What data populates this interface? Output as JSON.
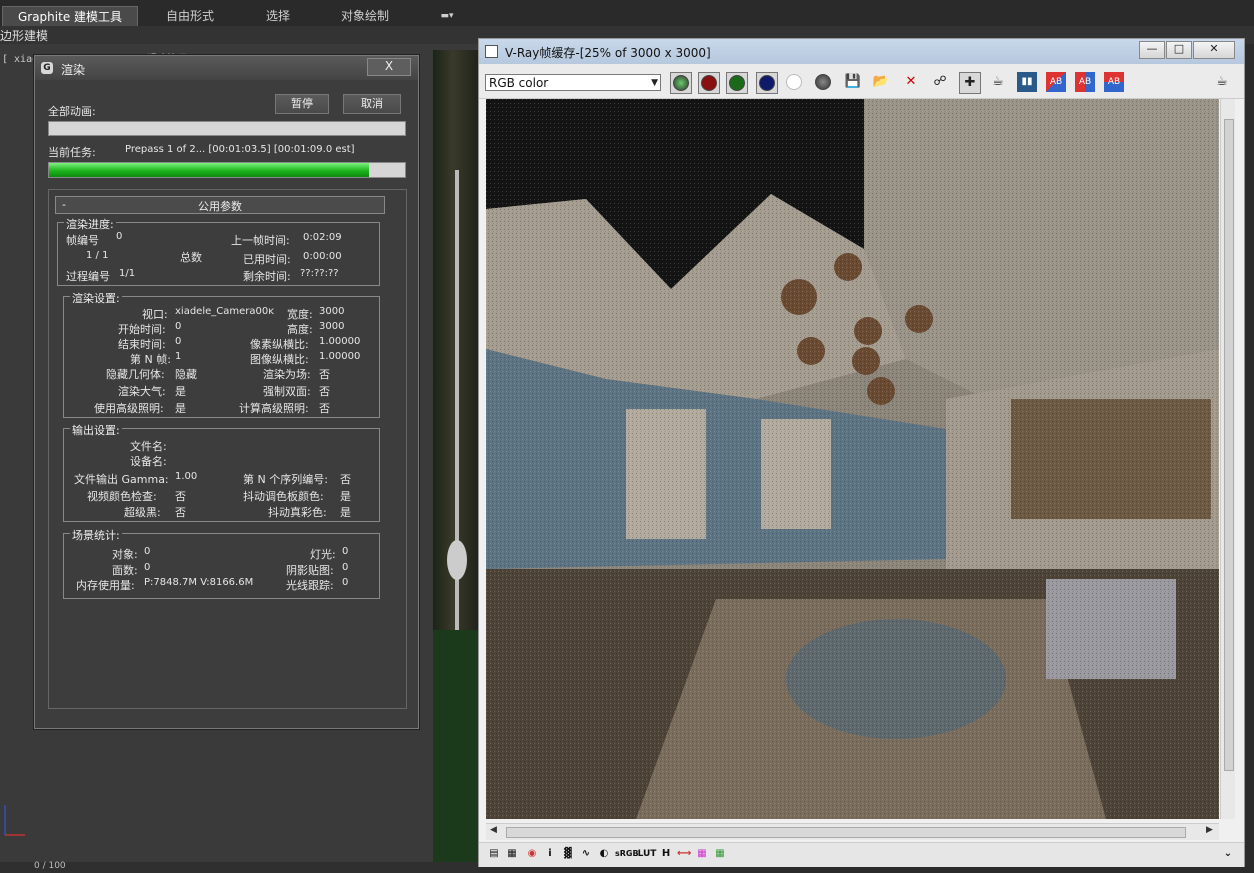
{
  "ribbon": {
    "tabs": [
      {
        "label": "Graphite 建模工具"
      },
      {
        "label": "自由形式"
      },
      {
        "label": "选择"
      },
      {
        "label": "对象绘制"
      }
    ],
    "sub_label": "边形建模"
  },
  "viewport": {
    "label": "[ xiadele_Camera004 ] [ 明暗处理 ]",
    "frame_counter": "0 / 100"
  },
  "render_dialog": {
    "title": "渲染",
    "close_label": "X",
    "all_anim_label": "全部动画:",
    "pause_label": "暂停",
    "cancel_label": "取消",
    "current_task_label": "当前任务:",
    "current_task_value": "Prepass 1 of 2... [00:01:03.5] [00:01:09.0 est]",
    "all_anim_progress": 0.0,
    "current_task_progress": 0.9,
    "rollout_sign": "-",
    "rollout_title": "公用参数",
    "progress_group": {
      "title": "渲染进度:",
      "frame_label": "帧编号",
      "frame_value": "0",
      "last_frame_label": "上一帧时间:",
      "last_frame_value": "0:02:09",
      "count_value": "1 / 1",
      "total_label": "总数",
      "elapsed_label": "已用时间:",
      "elapsed_value": "0:00:00",
      "pass_label": "过程编号",
      "pass_value": "1/1",
      "remaining_label": "剩余时间:",
      "remaining_value": "??:??:??"
    },
    "settings_group": {
      "title": "渲染设置:",
      "viewport_label": "视口:",
      "viewport_value": "xiadele_Camera00ĸ",
      "width_label": "宽度:",
      "width_value": "3000",
      "start_label": "开始时间:",
      "start_value": "0",
      "height_label": "高度:",
      "height_value": "3000",
      "end_label": "结束时间:",
      "end_value": "0",
      "pixel_aspect_label": "像素纵横比:",
      "pixel_aspect_value": "1.00000",
      "nth_label": "第 N 帧:",
      "nth_value": "1",
      "image_aspect_label": "图像纵横比:",
      "image_aspect_value": "1.00000",
      "hidden_geo_label": "隐藏几何体:",
      "hidden_geo_value": "隐藏",
      "render_fields_label": "渲染为场:",
      "render_fields_value": "否",
      "atmos_label": "渲染大气:",
      "atmos_value": "是",
      "force2s_label": "强制双面:",
      "force2s_value": "否",
      "adv_light_label": "使用高级照明:",
      "adv_light_value": "是",
      "calc_adv_label": "计算高级照明:",
      "calc_adv_value": "否"
    },
    "output_group": {
      "title": "输出设置:",
      "filename_label": "文件名:",
      "device_label": "设备名:",
      "gamma_label": "文件输出 Gamma:",
      "gamma_value": "1.00",
      "nth_seq_label": "第 N 个序列编号:",
      "nth_seq_value": "否",
      "video_check_label": "视频颜色检查:",
      "video_check_value": "否",
      "dither_pal_label": "抖动调色板颜色:",
      "dither_pal_value": "是",
      "superblack_label": "超级黑:",
      "superblack_value": "否",
      "dither_true_label": "抖动真彩色:",
      "dither_true_value": "是"
    },
    "scene_group": {
      "title": "场景统计:",
      "objects_label": "对象:",
      "objects_value": "0",
      "lights_label": "灯光:",
      "lights_value": "0",
      "faces_label": "面数:",
      "faces_value": "0",
      "shadow_label": "阴影贴图:",
      "shadow_value": "0",
      "memory_label": "内存使用量:",
      "memory_value": "P:7848.7M V:8166.6M",
      "raytrace_label": "光线跟踪:",
      "raytrace_value": "0"
    }
  },
  "vfb": {
    "title": "V-Ray帧缓存-[25% of 3000 x 3000]",
    "channel_select": "RGB color",
    "min_label": "—",
    "max_label": "□",
    "close_label": "✕",
    "toolbar_icons": [
      "track-mouse-icon",
      "red-channel-icon",
      "green-channel-icon",
      "blue-channel-icon",
      "alpha-channel-icon",
      "mono-icon",
      "save-icon",
      "open-icon",
      "clear-icon",
      "link-icon",
      "region-icon",
      "teapot-icon",
      "compare-icon",
      "ab-h-icon",
      "ab-v-icon",
      "ab-swap-icon",
      "teapot-render-icon"
    ],
    "status_icons": [
      "panel-icon",
      "history-icon",
      "color-corr-icon",
      "info-icon",
      "levels-icon",
      "curves-icon",
      "exposure-icon",
      "srgb-icon",
      "lut-icon",
      "h-icon",
      "ocio-icon",
      "colors-icon",
      "rgb-icon"
    ],
    "status_text": {
      "srgb": "sRGB",
      "lut": "LUT",
      "h": "H"
    }
  }
}
